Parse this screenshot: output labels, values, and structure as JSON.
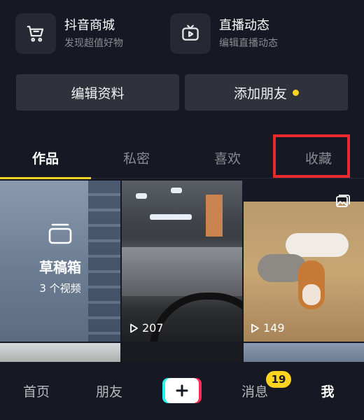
{
  "shortcuts": {
    "mall": {
      "title": "抖音商城",
      "subtitle": "发现超值好物",
      "icon": "cart-icon"
    },
    "live": {
      "title": "直播动态",
      "subtitle": "编辑直播动态",
      "icon": "tv-icon"
    }
  },
  "actions": {
    "edit_profile": "编辑资料",
    "add_friends": "添加朋友",
    "add_friends_dot_color": "#fcd31f"
  },
  "tabs": [
    {
      "label": "作品",
      "active": true
    },
    {
      "label": "私密",
      "active": false
    },
    {
      "label": "喜欢",
      "active": false
    },
    {
      "label": "收藏",
      "active": false,
      "highlighted": true
    }
  ],
  "grid": {
    "draft": {
      "title": "草稿箱",
      "subtitle": "3 个视频",
      "icon": "folder-icon"
    },
    "videos": [
      {
        "play_count": "207"
      },
      {
        "play_count": "149",
        "badge_icon": "image-icon"
      }
    ]
  },
  "bottom_nav": {
    "home": "首页",
    "friends": "朋友",
    "create_icon": "plus-icon",
    "messages": "消息",
    "messages_badge": "19",
    "me": "我"
  },
  "colors": {
    "background": "#161823",
    "accent_yellow": "#fcd31f",
    "highlight_red": "#e8292e",
    "brand_cyan": "#25f4ee",
    "brand_pink": "#fe2c55"
  }
}
